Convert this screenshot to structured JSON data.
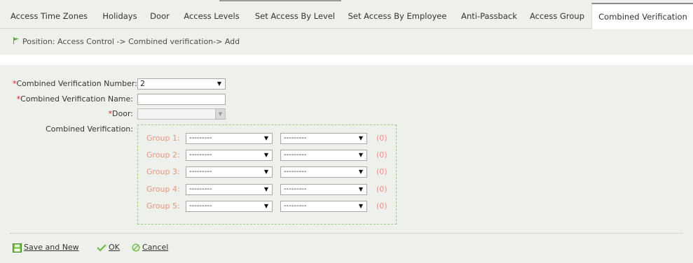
{
  "tabs": [
    {
      "label": "Access Time Zones",
      "active": false
    },
    {
      "label": "Holidays",
      "active": false
    },
    {
      "label": "Door",
      "active": false
    },
    {
      "label": "Access Levels",
      "active": false
    },
    {
      "label": "Set Access By Level",
      "active": false
    },
    {
      "label": "Set Access By Employee",
      "active": false
    },
    {
      "label": "Anti-Passback",
      "active": false
    },
    {
      "label": "Access Group",
      "active": false
    },
    {
      "label": "Combined Verification",
      "active": true
    }
  ],
  "breadcrumb": {
    "text": "Position: Access Control -> Combined verification-> Add",
    "icon": "flag-icon"
  },
  "form": {
    "required_mark": "*",
    "number_label": "Combined Verification Number:",
    "number_value": "2",
    "name_label": "Combined Verification Name:",
    "name_value": "",
    "door_label": "Door:",
    "door_value": "",
    "combined_label": "Combined Verification:"
  },
  "groups": [
    {
      "label": "Group 1:",
      "sel1": "---------",
      "sel2": "---------",
      "count": "(0)"
    },
    {
      "label": "Group 2:",
      "sel1": "---------",
      "sel2": "---------",
      "count": "(0)"
    },
    {
      "label": "Group 3:",
      "sel1": "---------",
      "sel2": "---------",
      "count": "(0)"
    },
    {
      "label": "Group 4:",
      "sel1": "---------",
      "sel2": "---------",
      "count": "(0)"
    },
    {
      "label": "Group 5:",
      "sel1": "---------",
      "sel2": "---------",
      "count": "(0)"
    }
  ],
  "actions": {
    "save_new": "Save and New",
    "ok": "OK",
    "cancel": "Cancel"
  },
  "colors": {
    "background": "#eef1eb",
    "group_label": "#e8957a",
    "required": "#dd2222",
    "ok_green": "#6cbf3a",
    "flag_green": "#5aa832"
  }
}
